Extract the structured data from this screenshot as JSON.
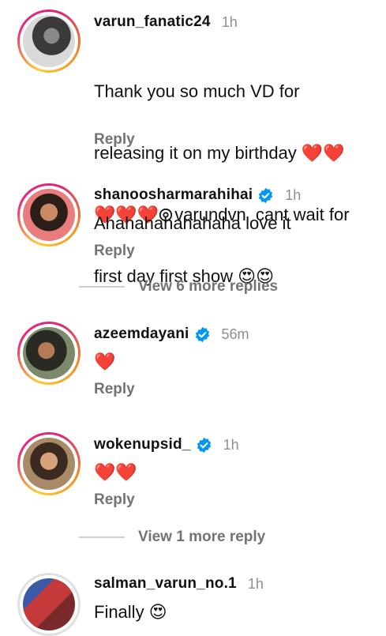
{
  "comments": [
    {
      "username": "varun_fanatic24",
      "time": "1h",
      "verified": false,
      "text_line1": "Thank you so much VD for",
      "text_line2": "releasing it on my birthday ❤️❤️",
      "text_line3_hearts": "❤️❤️❤️",
      "text_line3_mention": "varundvn",
      "text_line3_rest": "  cant wait for",
      "text_line4": "first day first show 😍😍",
      "reply": "Reply"
    },
    {
      "username": "shanoosharmarahihai",
      "time": "1h",
      "verified": true,
      "text": "Ahahahahahahaha love it",
      "reply": "Reply"
    },
    {
      "username": "azeemdayani",
      "time": "56m",
      "verified": true,
      "text": "❤️",
      "reply": "Reply"
    },
    {
      "username": "wokenupsid_",
      "time": "1h",
      "verified": true,
      "text": "❤️❤️",
      "reply": "Reply"
    },
    {
      "username": "salman_varun_no.1",
      "time": "1h",
      "verified": false,
      "text": "Finally 😍"
    }
  ],
  "view_more": [
    {
      "label": "View 6 more replies"
    },
    {
      "label": "View 1 more reply"
    }
  ],
  "colors": {
    "verified_blue": "#0095f6",
    "secondary_text": "#737373",
    "heart_red": "#e8252c"
  }
}
